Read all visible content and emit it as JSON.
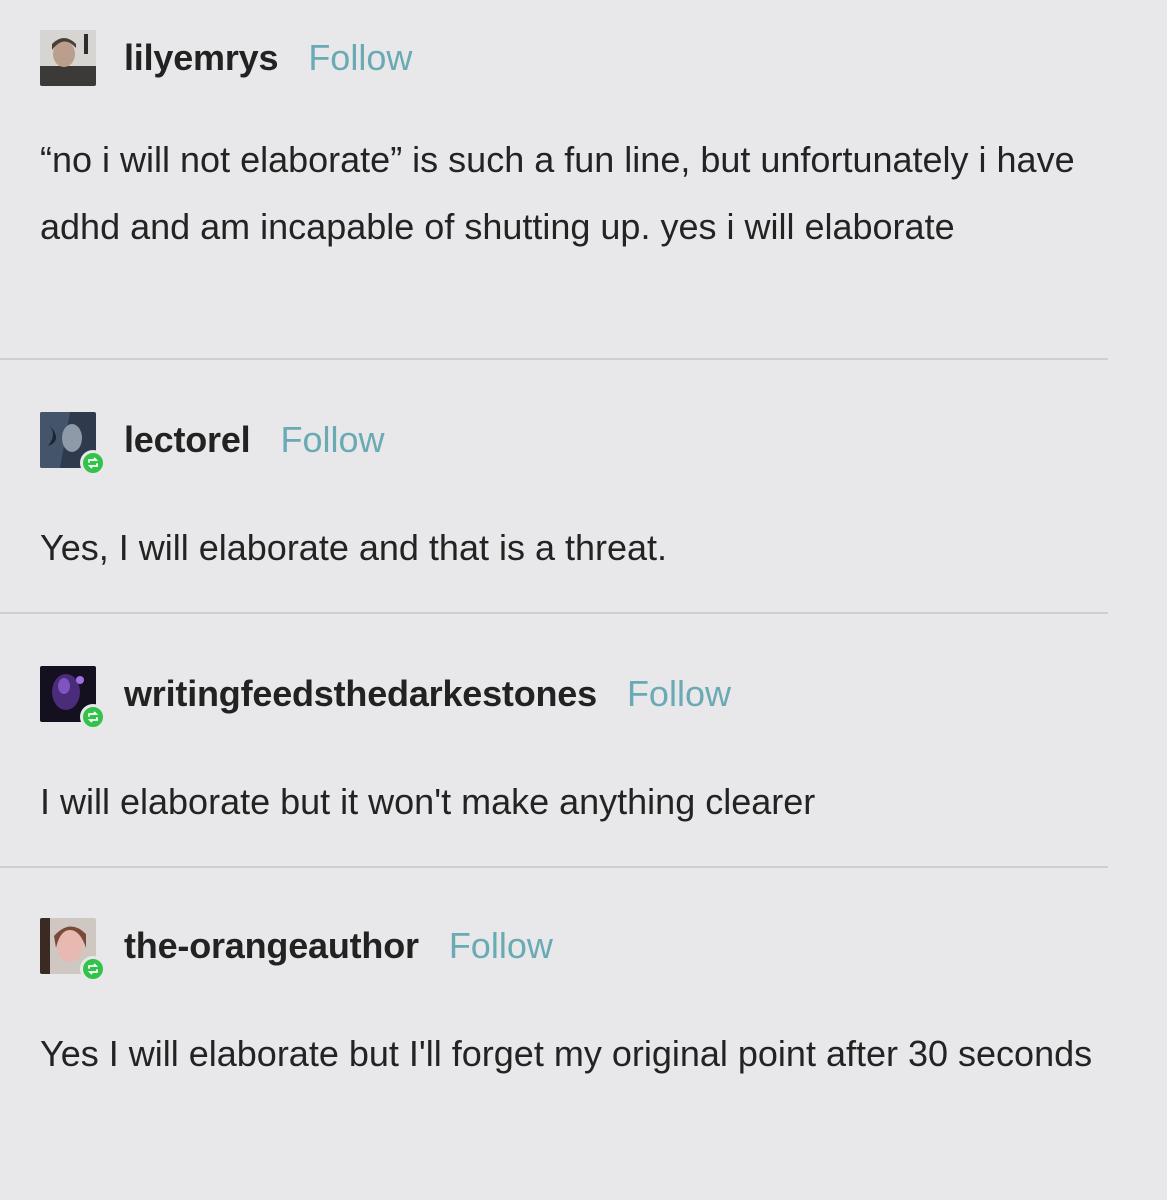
{
  "posts": [
    {
      "username": "lilyemrys",
      "follow_label": "Follow",
      "avatar_icon": "profile-photo-icon",
      "body": "“no i will not elaborate” is such a fun line, but unfortunately i have adhd and am incapable of shutting up. yes i will elaborate"
    },
    {
      "username": "lectorel",
      "follow_label": "Follow",
      "avatar_icon": "profile-photo-icon",
      "reblog_icon": "reblog-icon",
      "body": "Yes, I will elaborate and that is a threat."
    },
    {
      "username": "writingfeedsthedarkestones",
      "follow_label": "Follow",
      "avatar_icon": "profile-photo-icon",
      "reblog_icon": "reblog-icon",
      "body": "I will elaborate but it won't make anything clearer"
    },
    {
      "username": "the-orangeauthor",
      "follow_label": "Follow",
      "avatar_icon": "profile-photo-icon",
      "reblog_icon": "reblog-icon",
      "body": "Yes I will elaborate but I'll forget my original point after 30 seconds"
    }
  ],
  "colors": {
    "background": "#e8e8ea",
    "follow_link": "#6aaab4",
    "reblog_badge": "#33c34a",
    "divider": "#cfcfd2"
  }
}
